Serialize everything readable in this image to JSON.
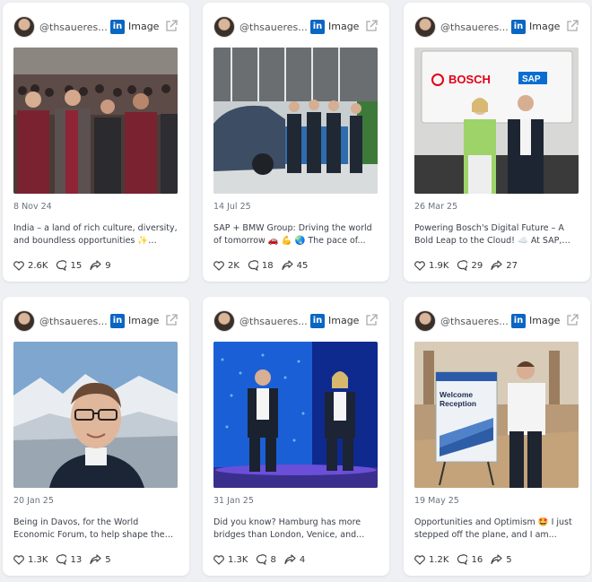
{
  "cards": [
    {
      "handle": "@thsaueres...",
      "type": "Image",
      "date": "8 Nov 24",
      "text": "India – a land of rich culture, diversity, and boundless opportunities ✨ Every...",
      "likes": "2.6K",
      "comments": "15",
      "shares": "9"
    },
    {
      "handle": "@thsaueres...",
      "type": "Image",
      "date": "14 Jul 25",
      "text": "SAP + BMW Group: Driving the world of tomorrow 🚗 💪 🌏  The pace of...",
      "likes": "2K",
      "comments": "18",
      "shares": "45"
    },
    {
      "handle": "@thsaueres...",
      "type": "Image",
      "date": "26 Mar 25",
      "text": "Powering Bosch's Digital Future – A Bold Leap to the Cloud! ☁️  At SAP, we...",
      "likes": "1.9K",
      "comments": "29",
      "shares": "27",
      "photo_text": {
        "left_logo": "BOSCH",
        "right_logo": "SAP"
      }
    },
    {
      "handle": "@thsaueres...",
      "type": "Image",
      "date": "20 Jan 25",
      "text": "Being in Davos, for the World Economic Forum, to help shape the conversatio...",
      "likes": "1.3K",
      "comments": "13",
      "shares": "5"
    },
    {
      "handle": "@thsaueres...",
      "type": "Image",
      "date": "31 Jan 25",
      "text": "Did you know? Hamburg has more bridges than London, Venice, and...",
      "likes": "1.3K",
      "comments": "8",
      "shares": "4"
    },
    {
      "handle": "@thsaueres...",
      "type": "Image",
      "date": "19 May 25",
      "text": "Opportunities and Optimism 🤩  I just stepped off the plane, and I am...",
      "likes": "1.2K",
      "comments": "16",
      "shares": "5",
      "photo_text": {
        "sign": "Welcome Reception"
      }
    }
  ],
  "icons": {
    "linkedin": "linkedin-icon",
    "external": "external-link-icon",
    "like": "heart-icon",
    "comment": "comment-icon",
    "share": "share-icon"
  },
  "colors": {
    "linkedin": "#0a66c2",
    "background": "#eef0f3"
  }
}
